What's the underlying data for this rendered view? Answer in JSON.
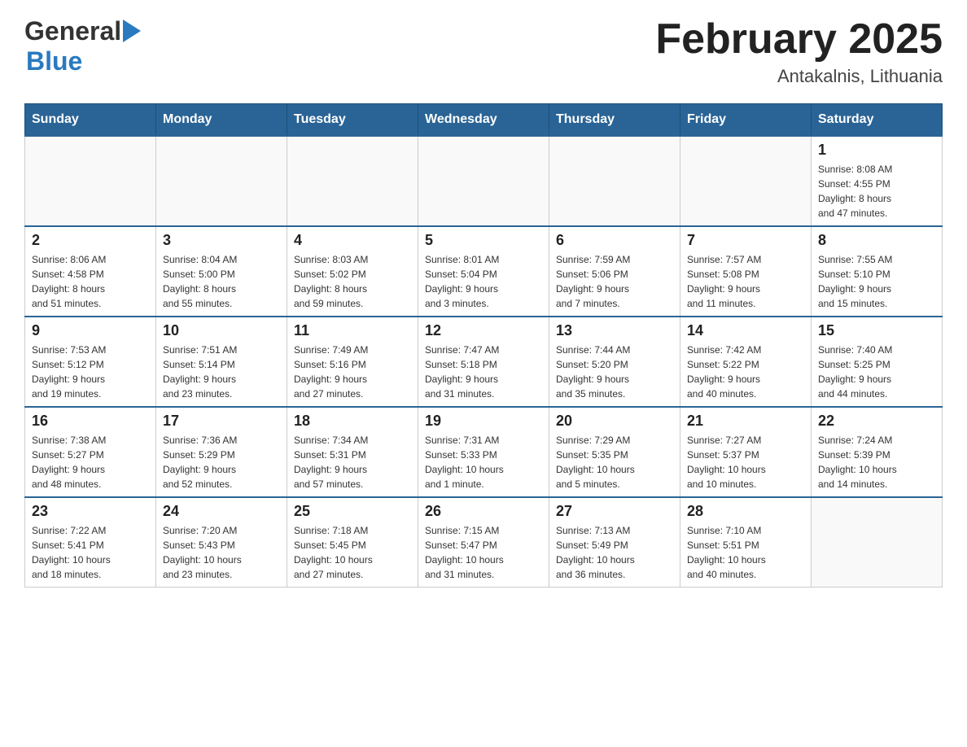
{
  "header": {
    "logo_general": "General",
    "logo_blue": "Blue",
    "title": "February 2025",
    "subtitle": "Antakalnis, Lithuania"
  },
  "days_of_week": [
    "Sunday",
    "Monday",
    "Tuesday",
    "Wednesday",
    "Thursday",
    "Friday",
    "Saturday"
  ],
  "weeks": [
    [
      {
        "day": "",
        "info": ""
      },
      {
        "day": "",
        "info": ""
      },
      {
        "day": "",
        "info": ""
      },
      {
        "day": "",
        "info": ""
      },
      {
        "day": "",
        "info": ""
      },
      {
        "day": "",
        "info": ""
      },
      {
        "day": "1",
        "info": "Sunrise: 8:08 AM\nSunset: 4:55 PM\nDaylight: 8 hours\nand 47 minutes."
      }
    ],
    [
      {
        "day": "2",
        "info": "Sunrise: 8:06 AM\nSunset: 4:58 PM\nDaylight: 8 hours\nand 51 minutes."
      },
      {
        "day": "3",
        "info": "Sunrise: 8:04 AM\nSunset: 5:00 PM\nDaylight: 8 hours\nand 55 minutes."
      },
      {
        "day": "4",
        "info": "Sunrise: 8:03 AM\nSunset: 5:02 PM\nDaylight: 8 hours\nand 59 minutes."
      },
      {
        "day": "5",
        "info": "Sunrise: 8:01 AM\nSunset: 5:04 PM\nDaylight: 9 hours\nand 3 minutes."
      },
      {
        "day": "6",
        "info": "Sunrise: 7:59 AM\nSunset: 5:06 PM\nDaylight: 9 hours\nand 7 minutes."
      },
      {
        "day": "7",
        "info": "Sunrise: 7:57 AM\nSunset: 5:08 PM\nDaylight: 9 hours\nand 11 minutes."
      },
      {
        "day": "8",
        "info": "Sunrise: 7:55 AM\nSunset: 5:10 PM\nDaylight: 9 hours\nand 15 minutes."
      }
    ],
    [
      {
        "day": "9",
        "info": "Sunrise: 7:53 AM\nSunset: 5:12 PM\nDaylight: 9 hours\nand 19 minutes."
      },
      {
        "day": "10",
        "info": "Sunrise: 7:51 AM\nSunset: 5:14 PM\nDaylight: 9 hours\nand 23 minutes."
      },
      {
        "day": "11",
        "info": "Sunrise: 7:49 AM\nSunset: 5:16 PM\nDaylight: 9 hours\nand 27 minutes."
      },
      {
        "day": "12",
        "info": "Sunrise: 7:47 AM\nSunset: 5:18 PM\nDaylight: 9 hours\nand 31 minutes."
      },
      {
        "day": "13",
        "info": "Sunrise: 7:44 AM\nSunset: 5:20 PM\nDaylight: 9 hours\nand 35 minutes."
      },
      {
        "day": "14",
        "info": "Sunrise: 7:42 AM\nSunset: 5:22 PM\nDaylight: 9 hours\nand 40 minutes."
      },
      {
        "day": "15",
        "info": "Sunrise: 7:40 AM\nSunset: 5:25 PM\nDaylight: 9 hours\nand 44 minutes."
      }
    ],
    [
      {
        "day": "16",
        "info": "Sunrise: 7:38 AM\nSunset: 5:27 PM\nDaylight: 9 hours\nand 48 minutes."
      },
      {
        "day": "17",
        "info": "Sunrise: 7:36 AM\nSunset: 5:29 PM\nDaylight: 9 hours\nand 52 minutes."
      },
      {
        "day": "18",
        "info": "Sunrise: 7:34 AM\nSunset: 5:31 PM\nDaylight: 9 hours\nand 57 minutes."
      },
      {
        "day": "19",
        "info": "Sunrise: 7:31 AM\nSunset: 5:33 PM\nDaylight: 10 hours\nand 1 minute."
      },
      {
        "day": "20",
        "info": "Sunrise: 7:29 AM\nSunset: 5:35 PM\nDaylight: 10 hours\nand 5 minutes."
      },
      {
        "day": "21",
        "info": "Sunrise: 7:27 AM\nSunset: 5:37 PM\nDaylight: 10 hours\nand 10 minutes."
      },
      {
        "day": "22",
        "info": "Sunrise: 7:24 AM\nSunset: 5:39 PM\nDaylight: 10 hours\nand 14 minutes."
      }
    ],
    [
      {
        "day": "23",
        "info": "Sunrise: 7:22 AM\nSunset: 5:41 PM\nDaylight: 10 hours\nand 18 minutes."
      },
      {
        "day": "24",
        "info": "Sunrise: 7:20 AM\nSunset: 5:43 PM\nDaylight: 10 hours\nand 23 minutes."
      },
      {
        "day": "25",
        "info": "Sunrise: 7:18 AM\nSunset: 5:45 PM\nDaylight: 10 hours\nand 27 minutes."
      },
      {
        "day": "26",
        "info": "Sunrise: 7:15 AM\nSunset: 5:47 PM\nDaylight: 10 hours\nand 31 minutes."
      },
      {
        "day": "27",
        "info": "Sunrise: 7:13 AM\nSunset: 5:49 PM\nDaylight: 10 hours\nand 36 minutes."
      },
      {
        "day": "28",
        "info": "Sunrise: 7:10 AM\nSunset: 5:51 PM\nDaylight: 10 hours\nand 40 minutes."
      },
      {
        "day": "",
        "info": ""
      }
    ]
  ]
}
